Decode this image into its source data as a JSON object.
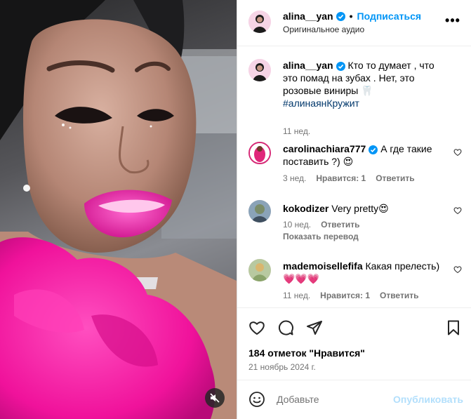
{
  "media": {
    "mute_icon": "speaker-muted-icon"
  },
  "header": {
    "username": "alina__yan",
    "separator": "•",
    "follow_label": "Подписаться",
    "audio_label": "Оригинальное аудио",
    "more_icon": "more-horizontal-icon",
    "more_label": "•••"
  },
  "caption": {
    "username": "alina__yan",
    "text": "Кто то думает , что это помад на зубах . Нет, это розовые виниры 🦷",
    "hashtag": "#алинаянКружит",
    "time": "11 нед."
  },
  "comments": [
    {
      "username": "carolinachiara777",
      "verified": true,
      "text": "А где такие поставить ?) 😍",
      "time": "3 нед.",
      "likes": "Нравится: 1",
      "reply": "Ответить"
    },
    {
      "username": "kokodizer",
      "verified": false,
      "text": "Very pretty😍",
      "time": "10 нед.",
      "reply": "Ответить",
      "translate": "Показать перевод"
    },
    {
      "username": "mademoisellefifa",
      "verified": false,
      "text": "Какая прелесть)💗💗💗",
      "time": "11 нед.",
      "likes": "Нравится: 1",
      "reply": "Ответить"
    }
  ],
  "actions": {
    "like_icon": "heart-icon",
    "comment_icon": "comment-icon",
    "share_icon": "paper-plane-icon",
    "save_icon": "bookmark-icon",
    "likes_text": "184 отметок \"Нравится\"",
    "date": "21 ноябрь 2024 г."
  },
  "composer": {
    "emoji_icon": "smiley-icon",
    "placeholder": "Добавьте",
    "post_label": "Опубликовать"
  },
  "colors": {
    "link_blue": "#0095f6",
    "hashtag_blue": "#00376b",
    "muted_text": "#737373",
    "post_disabled": "#b2dffc",
    "dress_pink": "#ff1aa8"
  }
}
